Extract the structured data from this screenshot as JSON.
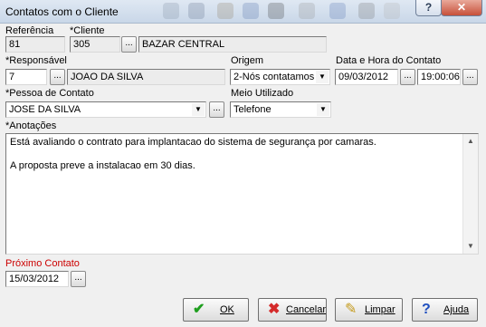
{
  "window": {
    "title": "Contatos com o Cliente",
    "help_label": "?",
    "close_label": "✕"
  },
  "referencia": {
    "label": "Referência",
    "value": "81"
  },
  "cliente": {
    "label": "*Cliente",
    "code": "305",
    "name": "BAZAR CENTRAL"
  },
  "responsavel": {
    "label": "*Responsável",
    "code": "7",
    "name": "JOAO DA SILVA"
  },
  "origem": {
    "label": "Origem",
    "value": "2-Nós contatamos"
  },
  "data_hora": {
    "label": "Data e Hora do Contato",
    "date": "09/03/2012",
    "time": "19:00:06"
  },
  "pessoa": {
    "label": "*Pessoa de Contato",
    "value": "JOSE DA SILVA"
  },
  "meio": {
    "label": "Meio Utilizado",
    "value": "Telefone"
  },
  "anotacoes": {
    "label": "*Anotações",
    "lines": [
      "Está avaliando o contrato para implantacao do sistema de segurança por camaras.",
      "A proposta preve a instalacao em 30 dias."
    ]
  },
  "proximo": {
    "label": "Próximo Contato",
    "value": "15/03/2012"
  },
  "ellipsis": "...",
  "dropdown_glyph": "▼",
  "buttons": {
    "ok": "OK",
    "cancelar": "Cancelar",
    "limpar": "Limpar",
    "ajuda": "Ajuda"
  },
  "icons": {
    "ok": "checkmark-icon",
    "cancelar": "x-icon",
    "limpar": "broom-icon",
    "ajuda": "help-icon"
  },
  "colors": {
    "required_red": "#cc0000",
    "ok_green": "#1e9e1e",
    "cancel_red": "#d42a2a",
    "help_blue": "#1f4fbf"
  }
}
